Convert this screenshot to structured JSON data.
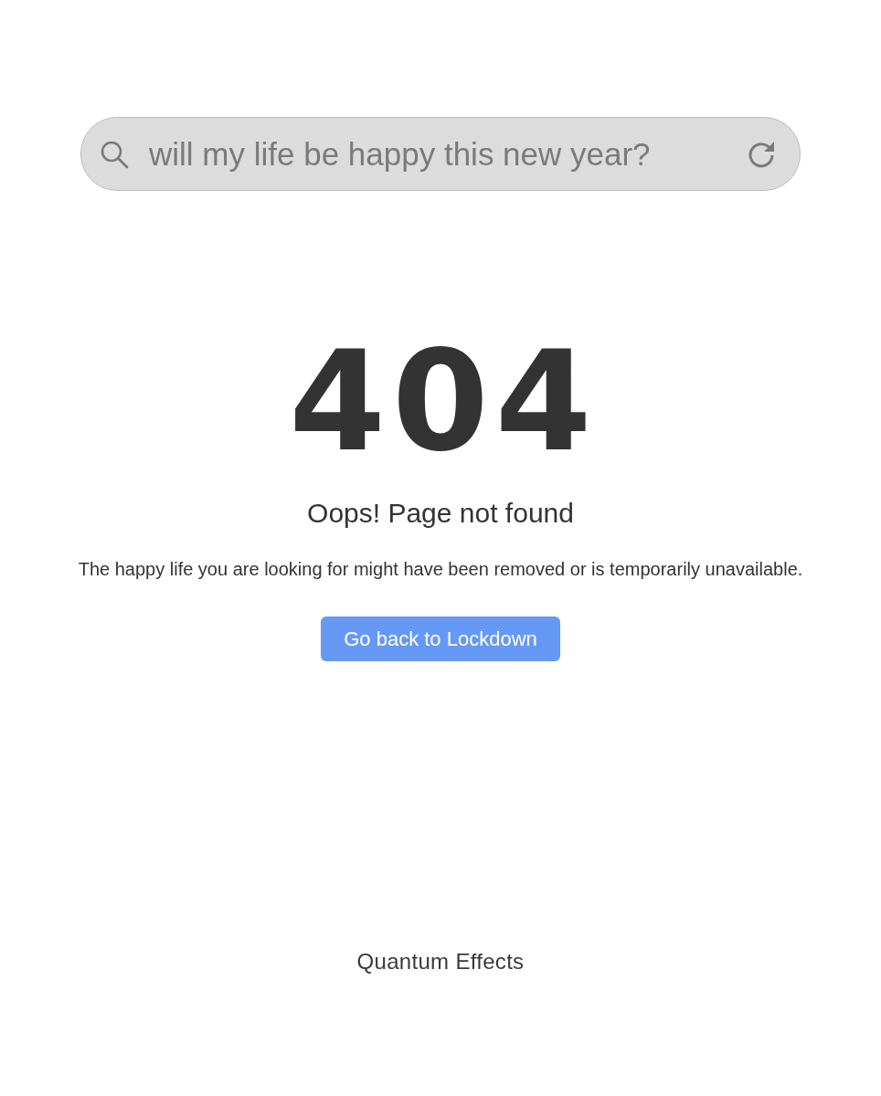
{
  "search": {
    "value": "will my life be happy this new year?"
  },
  "error": {
    "code": "404",
    "title": "Oops! Page not found",
    "message": "The happy life you are looking for might have been removed or is temporarily unavailable.",
    "button": "Go back to Lockdown"
  },
  "footer": {
    "brand": "Quantum Effects"
  }
}
